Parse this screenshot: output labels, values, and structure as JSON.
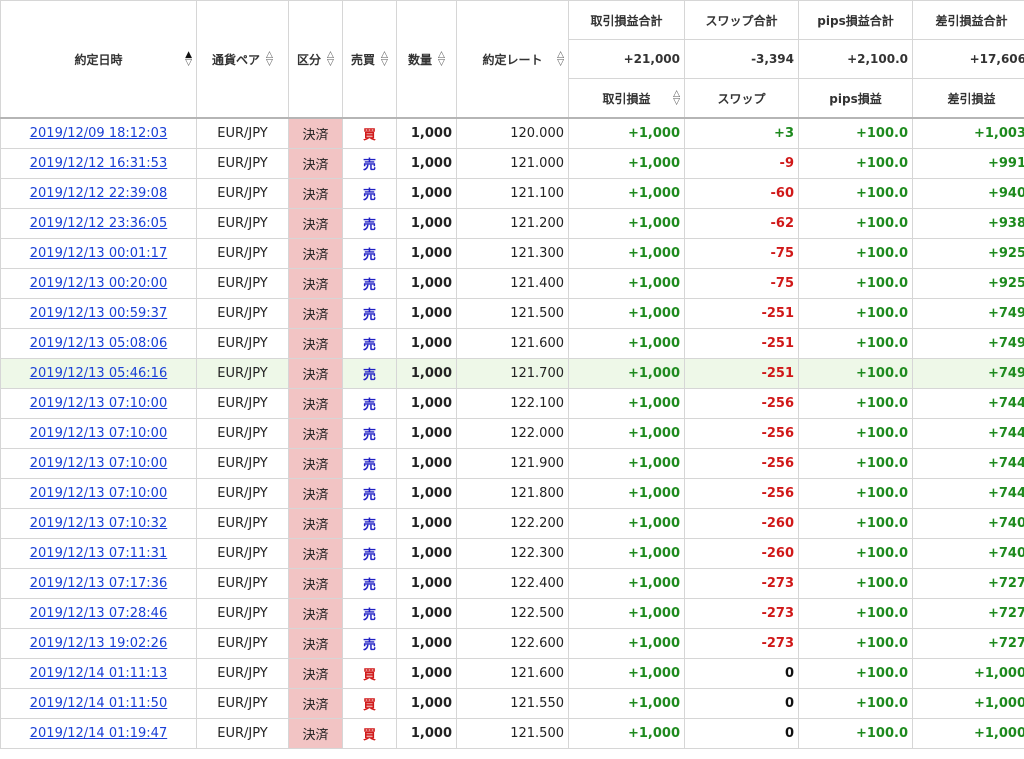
{
  "headers": {
    "date": "約定日時",
    "pair": "通貨ペア",
    "kubun": "区分",
    "side": "売買",
    "qty": "数量",
    "rate": "約定レート",
    "trade_pl_total": "取引損益合計",
    "swap_total": "スワップ合計",
    "pips_total": "pips損益合計",
    "net_total": "差引損益合計",
    "trade_pl": "取引損益",
    "swap": "スワップ",
    "pips": "pips損益",
    "net": "差引損益"
  },
  "totals": {
    "trade_pl": "+21,000",
    "swap": "-3,394",
    "pips": "+2,100.0",
    "net": "+17,606"
  },
  "sort_icons": {
    "up": "▲",
    "up_outline": "△",
    "down": "▽"
  },
  "colors": {
    "positive": "#1e8a1e",
    "negative": "#d01818",
    "buy": "#d01818",
    "sell": "#2222c4",
    "link": "#1a3fd6",
    "kubun_bg": "#f2c4c4",
    "highlight_row": "#eef8e8"
  },
  "rows": [
    {
      "date": "2019/12/09 18:12:03",
      "pair": "EUR/JPY",
      "kubun": "決済",
      "side": "買",
      "qty": "1,000",
      "rate": "120.000",
      "trade_pl": "+1,000",
      "swap": "+3",
      "pips": "+100.0",
      "net": "+1,003"
    },
    {
      "date": "2019/12/12 16:31:53",
      "pair": "EUR/JPY",
      "kubun": "決済",
      "side": "売",
      "qty": "1,000",
      "rate": "121.000",
      "trade_pl": "+1,000",
      "swap": "-9",
      "pips": "+100.0",
      "net": "+991"
    },
    {
      "date": "2019/12/12 22:39:08",
      "pair": "EUR/JPY",
      "kubun": "決済",
      "side": "売",
      "qty": "1,000",
      "rate": "121.100",
      "trade_pl": "+1,000",
      "swap": "-60",
      "pips": "+100.0",
      "net": "+940"
    },
    {
      "date": "2019/12/12 23:36:05",
      "pair": "EUR/JPY",
      "kubun": "決済",
      "side": "売",
      "qty": "1,000",
      "rate": "121.200",
      "trade_pl": "+1,000",
      "swap": "-62",
      "pips": "+100.0",
      "net": "+938"
    },
    {
      "date": "2019/12/13 00:01:17",
      "pair": "EUR/JPY",
      "kubun": "決済",
      "side": "売",
      "qty": "1,000",
      "rate": "121.300",
      "trade_pl": "+1,000",
      "swap": "-75",
      "pips": "+100.0",
      "net": "+925"
    },
    {
      "date": "2019/12/13 00:20:00",
      "pair": "EUR/JPY",
      "kubun": "決済",
      "side": "売",
      "qty": "1,000",
      "rate": "121.400",
      "trade_pl": "+1,000",
      "swap": "-75",
      "pips": "+100.0",
      "net": "+925"
    },
    {
      "date": "2019/12/13 00:59:37",
      "pair": "EUR/JPY",
      "kubun": "決済",
      "side": "売",
      "qty": "1,000",
      "rate": "121.500",
      "trade_pl": "+1,000",
      "swap": "-251",
      "pips": "+100.0",
      "net": "+749"
    },
    {
      "date": "2019/12/13 05:08:06",
      "pair": "EUR/JPY",
      "kubun": "決済",
      "side": "売",
      "qty": "1,000",
      "rate": "121.600",
      "trade_pl": "+1,000",
      "swap": "-251",
      "pips": "+100.0",
      "net": "+749"
    },
    {
      "date": "2019/12/13 05:46:16",
      "pair": "EUR/JPY",
      "kubun": "決済",
      "side": "売",
      "qty": "1,000",
      "rate": "121.700",
      "trade_pl": "+1,000",
      "swap": "-251",
      "pips": "+100.0",
      "net": "+749",
      "highlight": true
    },
    {
      "date": "2019/12/13 07:10:00",
      "pair": "EUR/JPY",
      "kubun": "決済",
      "side": "売",
      "qty": "1,000",
      "rate": "122.100",
      "trade_pl": "+1,000",
      "swap": "-256",
      "pips": "+100.0",
      "net": "+744"
    },
    {
      "date": "2019/12/13 07:10:00",
      "pair": "EUR/JPY",
      "kubun": "決済",
      "side": "売",
      "qty": "1,000",
      "rate": "122.000",
      "trade_pl": "+1,000",
      "swap": "-256",
      "pips": "+100.0",
      "net": "+744"
    },
    {
      "date": "2019/12/13 07:10:00",
      "pair": "EUR/JPY",
      "kubun": "決済",
      "side": "売",
      "qty": "1,000",
      "rate": "121.900",
      "trade_pl": "+1,000",
      "swap": "-256",
      "pips": "+100.0",
      "net": "+744"
    },
    {
      "date": "2019/12/13 07:10:00",
      "pair": "EUR/JPY",
      "kubun": "決済",
      "side": "売",
      "qty": "1,000",
      "rate": "121.800",
      "trade_pl": "+1,000",
      "swap": "-256",
      "pips": "+100.0",
      "net": "+744"
    },
    {
      "date": "2019/12/13 07:10:32",
      "pair": "EUR/JPY",
      "kubun": "決済",
      "side": "売",
      "qty": "1,000",
      "rate": "122.200",
      "trade_pl": "+1,000",
      "swap": "-260",
      "pips": "+100.0",
      "net": "+740"
    },
    {
      "date": "2019/12/13 07:11:31",
      "pair": "EUR/JPY",
      "kubun": "決済",
      "side": "売",
      "qty": "1,000",
      "rate": "122.300",
      "trade_pl": "+1,000",
      "swap": "-260",
      "pips": "+100.0",
      "net": "+740"
    },
    {
      "date": "2019/12/13 07:17:36",
      "pair": "EUR/JPY",
      "kubun": "決済",
      "side": "売",
      "qty": "1,000",
      "rate": "122.400",
      "trade_pl": "+1,000",
      "swap": "-273",
      "pips": "+100.0",
      "net": "+727"
    },
    {
      "date": "2019/12/13 07:28:46",
      "pair": "EUR/JPY",
      "kubun": "決済",
      "side": "売",
      "qty": "1,000",
      "rate": "122.500",
      "trade_pl": "+1,000",
      "swap": "-273",
      "pips": "+100.0",
      "net": "+727"
    },
    {
      "date": "2019/12/13 19:02:26",
      "pair": "EUR/JPY",
      "kubun": "決済",
      "side": "売",
      "qty": "1,000",
      "rate": "122.600",
      "trade_pl": "+1,000",
      "swap": "-273",
      "pips": "+100.0",
      "net": "+727"
    },
    {
      "date": "2019/12/14 01:11:13",
      "pair": "EUR/JPY",
      "kubun": "決済",
      "side": "買",
      "qty": "1,000",
      "rate": "121.600",
      "trade_pl": "+1,000",
      "swap": "0",
      "pips": "+100.0",
      "net": "+1,000"
    },
    {
      "date": "2019/12/14 01:11:50",
      "pair": "EUR/JPY",
      "kubun": "決済",
      "side": "買",
      "qty": "1,000",
      "rate": "121.550",
      "trade_pl": "+1,000",
      "swap": "0",
      "pips": "+100.0",
      "net": "+1,000"
    },
    {
      "date": "2019/12/14 01:19:47",
      "pair": "EUR/JPY",
      "kubun": "決済",
      "side": "買",
      "qty": "1,000",
      "rate": "121.500",
      "trade_pl": "+1,000",
      "swap": "0",
      "pips": "+100.0",
      "net": "+1,000"
    }
  ]
}
